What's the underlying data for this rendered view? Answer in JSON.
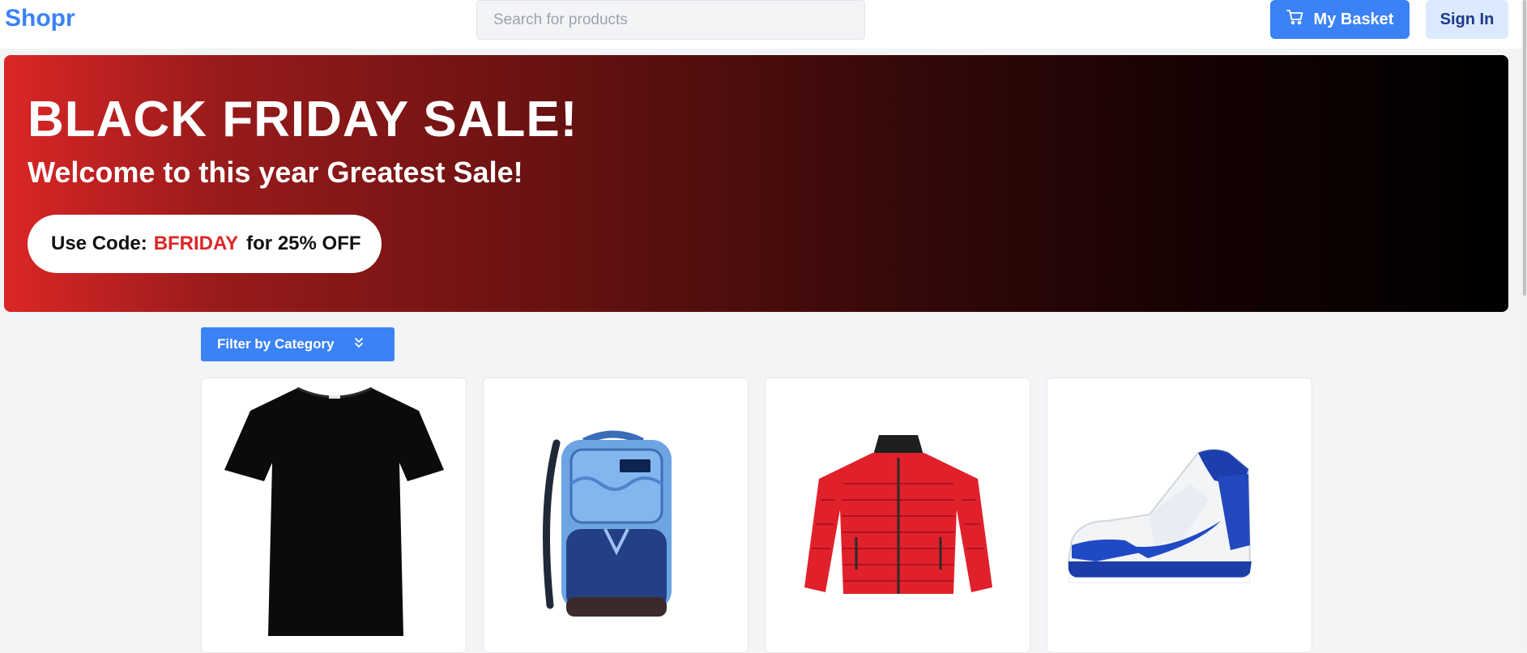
{
  "header": {
    "logo": "Shopr",
    "search_placeholder": "Search for products",
    "basket_label": "My Basket",
    "basket_icon": "cart-icon",
    "signin_label": "Sign In"
  },
  "banner": {
    "title": "BLACK FRIDAY SALE!",
    "subtitle": "Welcome to this year Greatest Sale!",
    "promo_prefix": "Use Code:",
    "promo_code": "BFRIDAY",
    "promo_suffix": "for 25% OFF"
  },
  "filters": {
    "category_label": "Filter by Category",
    "icon": "double-chevron-down-icon"
  },
  "products": [
    {
      "image": "black-tshirt-image"
    },
    {
      "image": "blue-backpack-image"
    },
    {
      "image": "red-puffer-jacket-image"
    },
    {
      "image": "blue-white-sneaker-image"
    }
  ],
  "colors": {
    "accent": "#3b82f6",
    "sale_red": "#dc2626",
    "signin_bg": "#dbeafe",
    "signin_text": "#1e3a8a"
  }
}
